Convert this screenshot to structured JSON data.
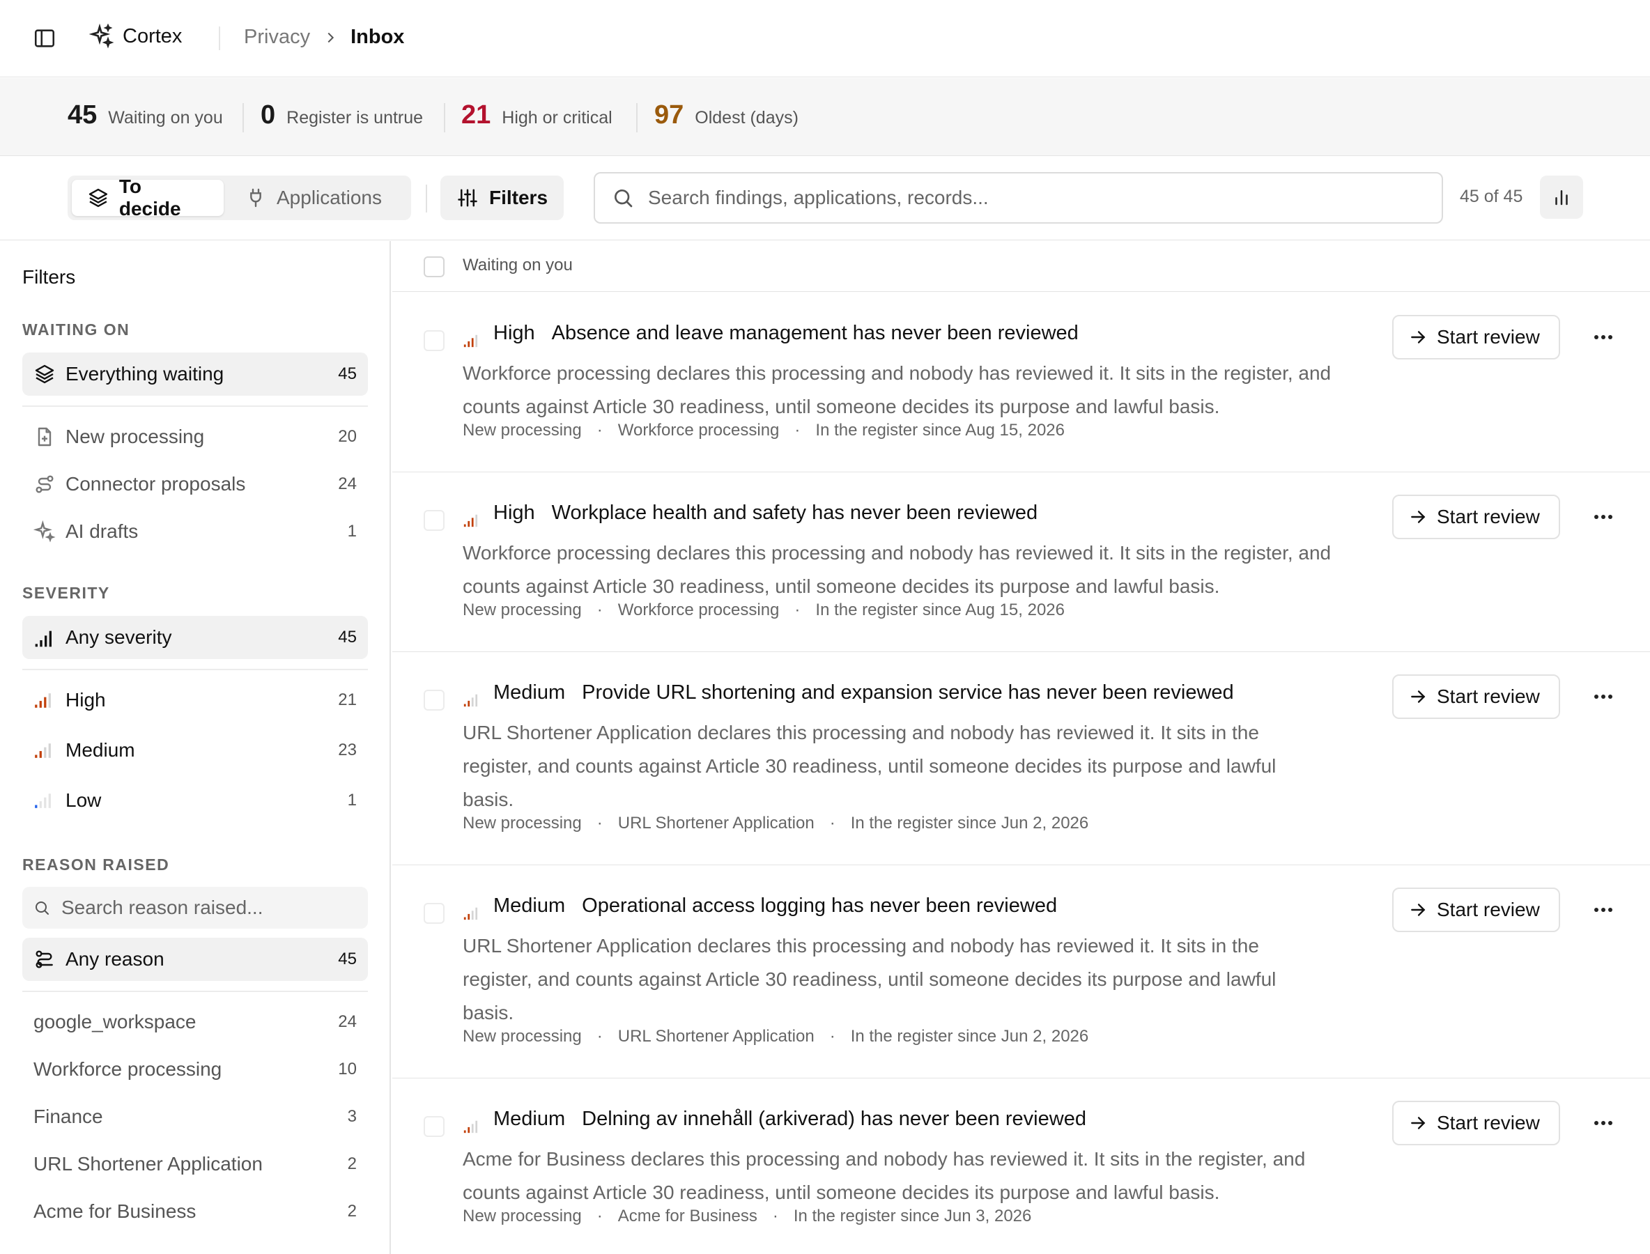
{
  "topbar": {
    "brand": "Cortex",
    "breadcrumb": [
      "Privacy",
      "Inbox"
    ]
  },
  "stats": [
    {
      "value": "45",
      "label": "Waiting on you",
      "color": "#1a1a1a"
    },
    {
      "value": "0",
      "label": "Register is untrue",
      "color": "#1a1a1a"
    },
    {
      "value": "21",
      "label": "High or critical",
      "color": "#b3122e"
    },
    {
      "value": "97",
      "label": "Oldest (days)",
      "color": "#9a5a0c"
    }
  ],
  "toolbar": {
    "tab_active": "To decide",
    "tab_inactive": "Applications",
    "filters_label": "Filters",
    "search_placeholder": "Search findings, applications, records...",
    "count": "45 of 45"
  },
  "sidebar": {
    "title": "Filters",
    "waiting_on": {
      "heading": "WAITING ON",
      "all": {
        "label": "Everything waiting",
        "count": "45"
      },
      "items": [
        {
          "label": "New processing",
          "count": "20"
        },
        {
          "label": "Connector proposals",
          "count": "24"
        },
        {
          "label": "AI drafts",
          "count": "1"
        }
      ]
    },
    "severity": {
      "heading": "SEVERITY",
      "all": {
        "label": "Any severity",
        "count": "45"
      },
      "items": [
        {
          "label": "High",
          "count": "21"
        },
        {
          "label": "Medium",
          "count": "23"
        },
        {
          "label": "Low",
          "count": "1"
        }
      ]
    },
    "reason": {
      "heading": "REASON RAISED",
      "search_placeholder": "Search reason raised...",
      "all": {
        "label": "Any reason",
        "count": "45"
      },
      "items": [
        {
          "label": "google_workspace",
          "count": "24"
        },
        {
          "label": "Workforce processing",
          "count": "10"
        },
        {
          "label": "Finance",
          "count": "3"
        },
        {
          "label": "URL Shortener Application",
          "count": "2"
        },
        {
          "label": "Acme for Business",
          "count": "2"
        }
      ]
    }
  },
  "list": {
    "header": "Waiting on you",
    "review_label": "Start review",
    "rows": [
      {
        "severity": "High",
        "title": "Absence and leave management has never been reviewed",
        "description": "Workforce processing declares this processing and nobody has reviewed it. It sits in the register, and counts against Article 30 readiness, until someone decides its purpose and lawful basis.",
        "meta": [
          "New processing",
          "Workforce processing",
          "In the register since Aug 15, 2026"
        ]
      },
      {
        "severity": "High",
        "title": "Workplace health and safety has never been reviewed",
        "description": "Workforce processing declares this processing and nobody has reviewed it. It sits in the register, and counts against Article 30 readiness, until someone decides its purpose and lawful basis.",
        "meta": [
          "New processing",
          "Workforce processing",
          "In the register since Aug 15, 2026"
        ]
      },
      {
        "severity": "Medium",
        "title": "Provide URL shortening and expansion service has never been reviewed",
        "description": "URL Shortener Application declares this processing and nobody has reviewed it. It sits in the register, and counts against Article 30 readiness, until someone decides its purpose and lawful basis.",
        "meta": [
          "New processing",
          "URL Shortener Application",
          "In the register since Jun 2, 2026"
        ]
      },
      {
        "severity": "Medium",
        "title": "Operational access logging has never been reviewed",
        "description": "URL Shortener Application declares this processing and nobody has reviewed it. It sits in the register, and counts against Article 30 readiness, until someone decides its purpose and lawful basis.",
        "meta": [
          "New processing",
          "URL Shortener Application",
          "In the register since Jun 2, 2026"
        ]
      },
      {
        "severity": "Medium",
        "title": "Delning av innehåll (arkiverad) has never been reviewed",
        "description": "Acme for Business declares this processing and nobody has reviewed it. It sits in the register, and counts against Article 30 readiness, until someone decides its purpose and lawful basis.",
        "meta": [
          "New processing",
          "Acme for Business",
          "In the register since Jun 3, 2026"
        ]
      }
    ]
  },
  "colors": {
    "high": "#c2410c",
    "medium": "#c2410c",
    "low": "#2563eb",
    "critical_text": "#b3122e",
    "oldest_text": "#9a5a0c"
  }
}
